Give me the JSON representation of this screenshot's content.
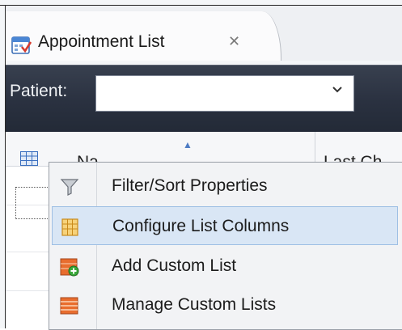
{
  "tab": {
    "title": "Appointment List",
    "close_glyph": "✕",
    "icon": "appointment-calendar-icon"
  },
  "patient_bar": {
    "label": "Patient:",
    "combo_value": "",
    "combo_arrow": "⌄"
  },
  "list": {
    "columns": [
      "Na",
      "Last Ch"
    ],
    "sort_glyph": "▲"
  },
  "context_menu": {
    "highlighted_index": 1,
    "items": [
      {
        "label": "Filter/Sort Properties",
        "icon": "funnel-icon"
      },
      {
        "label": "Configure List Columns",
        "icon": "columns-icon"
      },
      {
        "label": "Add Custom List",
        "icon": "add-list-icon"
      },
      {
        "label": "Manage Custom Lists",
        "icon": "manage-lists-icon"
      }
    ]
  },
  "colors": {
    "patient_bar": "#2a3140",
    "menu_highlight": "#d9e6f5",
    "icon_orange": "#e06a2a",
    "icon_green": "#3aa83a"
  }
}
